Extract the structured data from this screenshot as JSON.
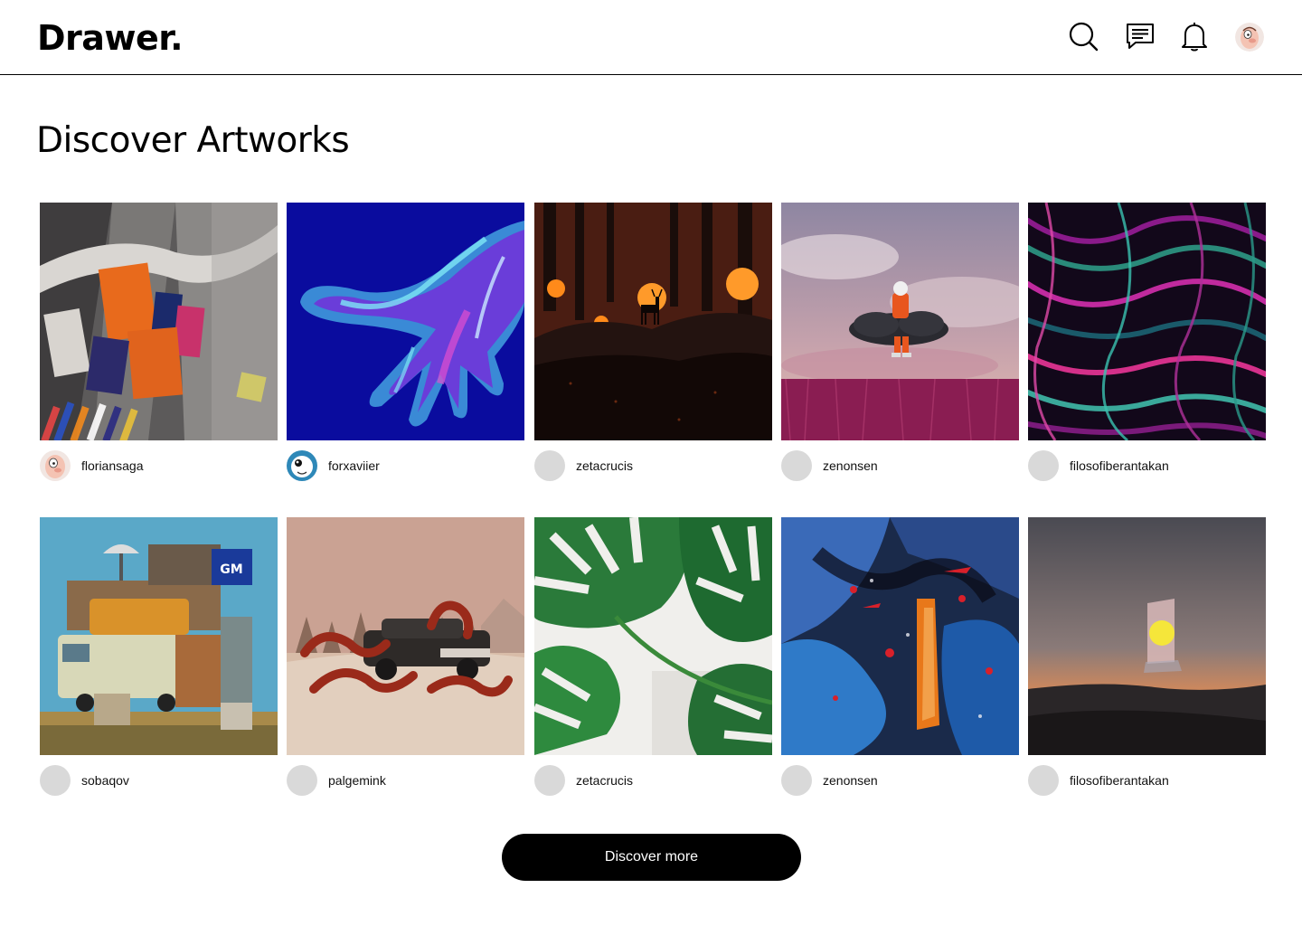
{
  "app": {
    "logo": "Drawer."
  },
  "header": {
    "icons": [
      "search-icon",
      "messages-icon",
      "bell-icon",
      "profile-avatar"
    ]
  },
  "page": {
    "title": "Discover Artworks"
  },
  "artworks": [
    {
      "user": "floriansaga",
      "art": "abstract-fabric-brushstrokes"
    },
    {
      "user": "forxaviier",
      "art": "holographic-hand"
    },
    {
      "user": "zetacrucis",
      "art": "forest-deer-orange-orbs"
    },
    {
      "user": "zenonsen",
      "art": "astronaut-on-cloud"
    },
    {
      "user": "filosofiberantakan",
      "art": "neon-fur-swirl"
    },
    {
      "user": "sobaqov",
      "art": "stacked-vans-tower"
    },
    {
      "user": "palgemink",
      "art": "octopus-car"
    },
    {
      "user": "zetacrucis",
      "art": "monstera-leaves"
    },
    {
      "user": "zenonsen",
      "art": "blue-orange-paint"
    },
    {
      "user": "filosofiberantakan",
      "art": "desert-portal-sun"
    }
  ],
  "footer": {
    "button_label": "Discover more"
  },
  "colors": {
    "accent": "#000000",
    "avatar_placeholder": "#d9d9d9"
  }
}
